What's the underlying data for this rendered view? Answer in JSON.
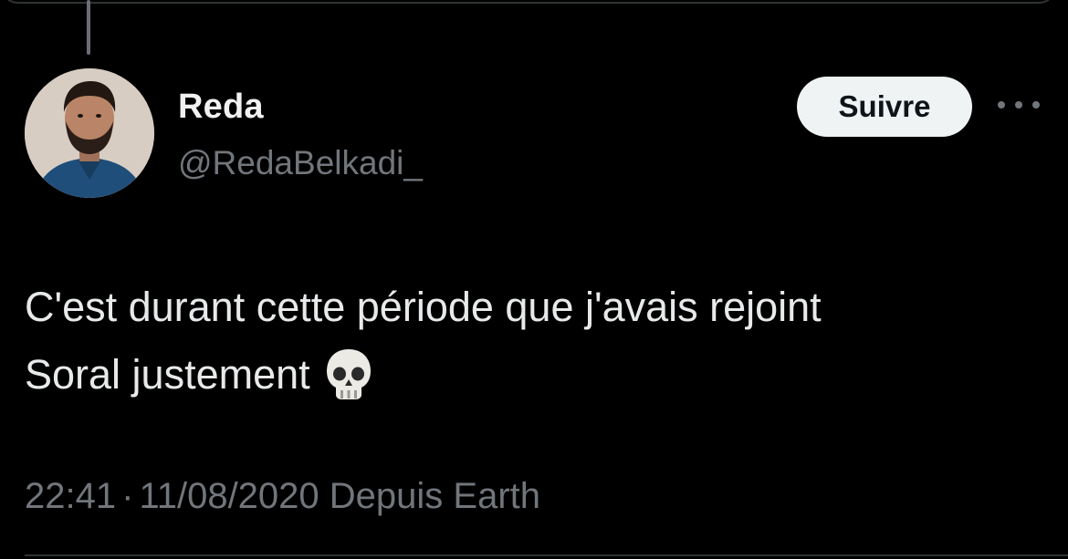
{
  "author": {
    "name": "Reda",
    "handle": "@RedaBelkadi_"
  },
  "actions": {
    "follow_label": "Suivre",
    "more_icon": "ellipsis-icon"
  },
  "tweet": {
    "text_line_1": "C'est durant cette période que j'avais rejoint",
    "text_line_2": "Soral justement",
    "emoji_icon": "skull-icon",
    "time": "22:41",
    "separator": "·",
    "date": "11/08/2020",
    "source": "Depuis Earth"
  },
  "colors": {
    "background": "#000000",
    "primary_text": "#e7e9ea",
    "secondary_text": "#71767b",
    "follow_button_bg": "#eff3f4",
    "divider": "#2f3336"
  }
}
